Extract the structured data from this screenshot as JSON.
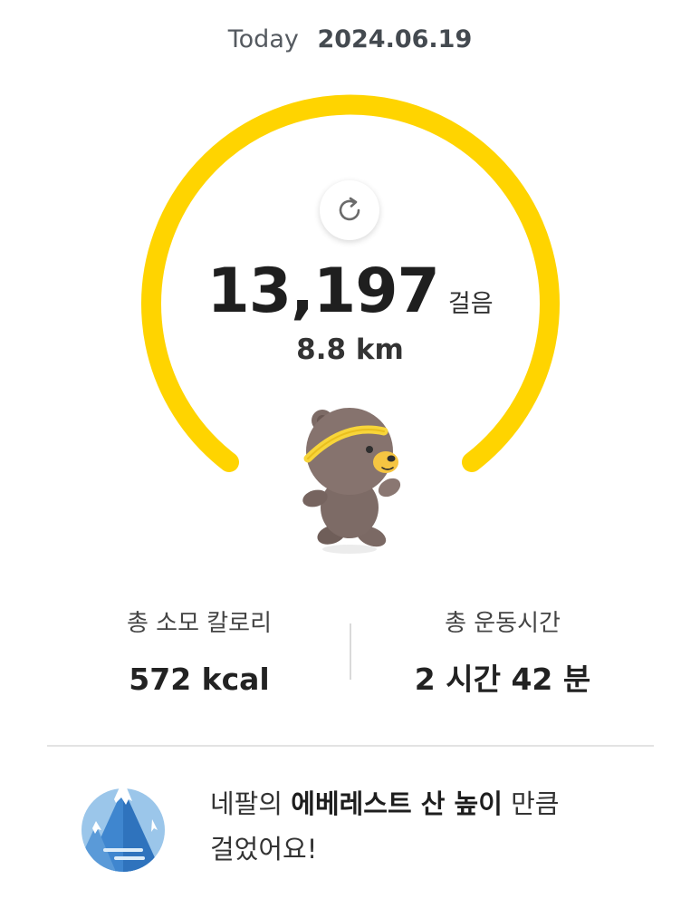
{
  "header": {
    "date_label": "Today",
    "date_value": "2024.06.19"
  },
  "gauge": {
    "color": "#FFD400",
    "progress": 1.0
  },
  "steps": {
    "value": "13,197",
    "unit": "걸음",
    "distance": "8.8 km"
  },
  "icons": {
    "refresh": "refresh-icon",
    "mascot": "bear-runner-mascot",
    "achievement": "mountain-icon"
  },
  "stats": {
    "calories_label": "총 소모 칼로리",
    "calories_value": "572 kcal",
    "time_label": "총 운동시간",
    "time_value": "2 시간 42 분"
  },
  "achievement": {
    "prefix": "네팔의 ",
    "highlight": "에베레스트 산 높이",
    "suffix": " 만큼",
    "line2": "걸었어요!"
  }
}
